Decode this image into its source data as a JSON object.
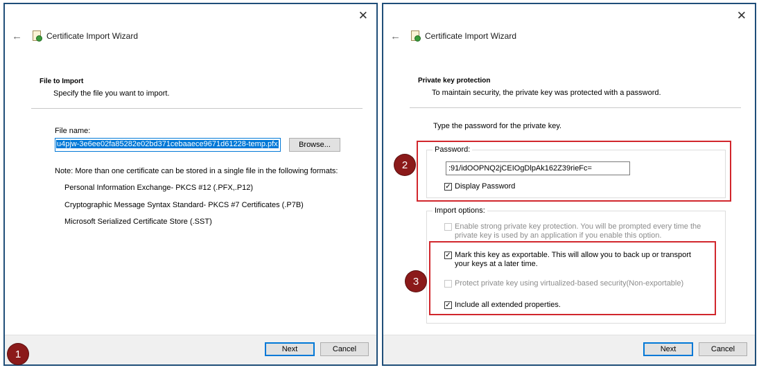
{
  "close_glyph": "✕",
  "back_glyph": "←",
  "check_glyph": "✓",
  "left": {
    "title": "Certificate Import Wizard",
    "section_title": "File to Import",
    "section_desc": "Specify the file you want to import.",
    "file_label": "File name:",
    "file_value": "u4pjw-3e6ee02fa85282e02bd371cebaaece9671d61228-temp.pfx",
    "browse_label": "Browse...",
    "note": "Note:  More than one certificate can be stored in a single file in the following formats:",
    "formats": [
      "Personal Information Exchange- PKCS #12 (.PFX,.P12)",
      "Cryptographic Message Syntax Standard- PKCS #7 Certificates (.P7B)",
      "Microsoft Serialized Certificate Store (.SST)"
    ],
    "next_label": "Next",
    "cancel_label": "Cancel",
    "step_badge": "1"
  },
  "right": {
    "title": "Certificate Import Wizard",
    "section_title": "Private key protection",
    "section_desc": "To maintain security, the private key was protected with a password.",
    "prompt": "Type the password for the private key.",
    "password_label": "Password:",
    "password_value": ":91/idOOPNQ2jCEIOgDlpAk162Z39rieFc=",
    "display_password": {
      "label": "Display Password",
      "checked": true
    },
    "import_options_label": "Import options:",
    "options": [
      {
        "label": "Enable strong private key protection. You will be prompted every time the private key is used by an application if you enable this option.",
        "checked": false,
        "enabled": false
      },
      {
        "label": "Mark this key as exportable. This will allow you to back up or transport your keys at a later time.",
        "checked": true,
        "enabled": true
      },
      {
        "label": "Protect private key using virtualized-based security(Non-exportable)",
        "checked": false,
        "enabled": false
      },
      {
        "label": "Include all extended properties.",
        "checked": true,
        "enabled": true
      }
    ],
    "next_label": "Next",
    "cancel_label": "Cancel",
    "badge_password": "2",
    "badge_options": "3"
  },
  "colors": {
    "window_border": "#1f4e79",
    "highlight_red": "#d1262c",
    "badge_fill": "#8b1a1a",
    "selection_blue": "#0078d7"
  }
}
